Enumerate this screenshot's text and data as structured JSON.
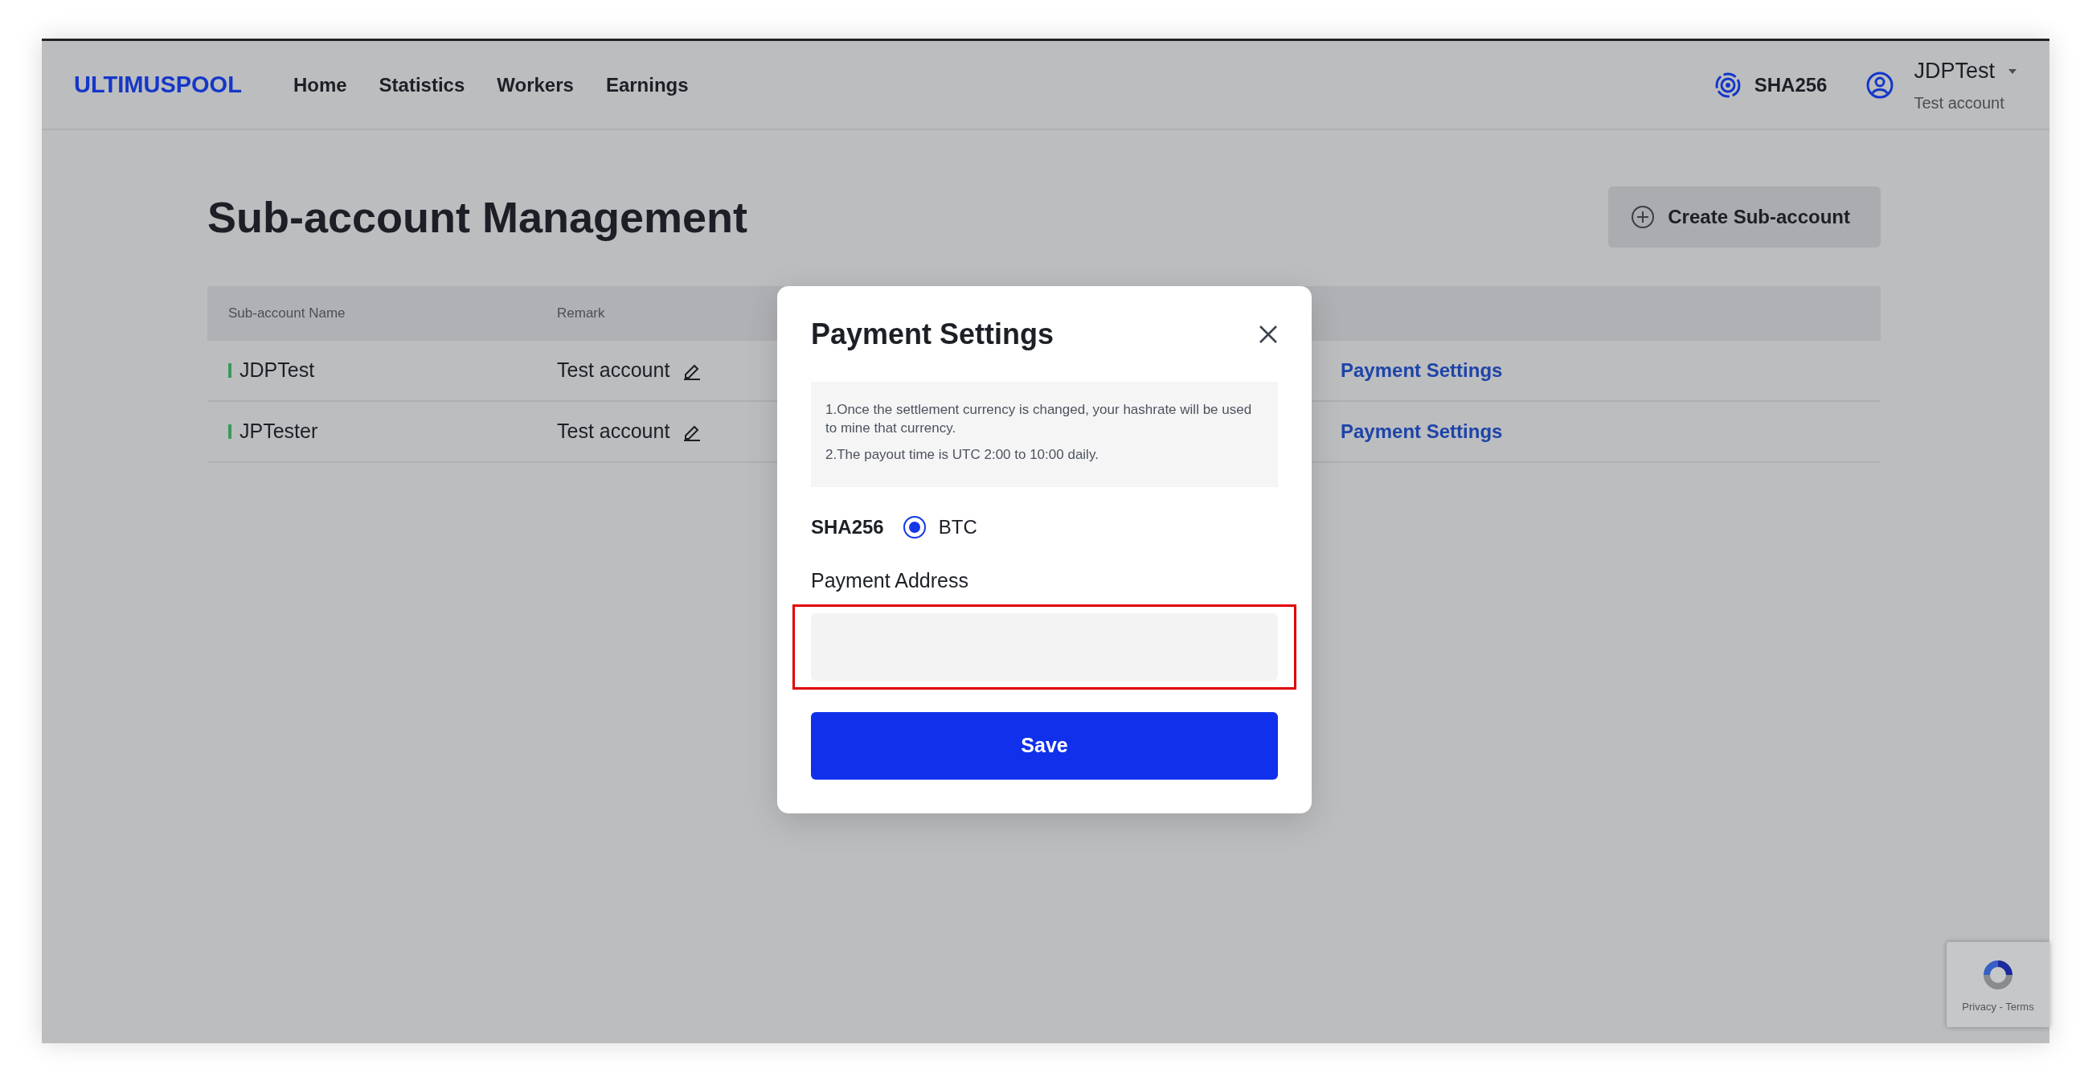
{
  "navbar": {
    "logo": "ULTIMUSPOOL",
    "links": [
      {
        "label": "Home"
      },
      {
        "label": "Statistics"
      },
      {
        "label": "Workers"
      },
      {
        "label": "Earnings"
      }
    ],
    "algorithm": "SHA256",
    "user": {
      "name": "JDPTest",
      "subtitle": "Test account"
    }
  },
  "page": {
    "title": "Sub-account Management",
    "create_button": "Create Sub-account"
  },
  "table": {
    "columns": [
      "Sub-account Name",
      "Remark"
    ],
    "rows": [
      {
        "name": "JDPTest",
        "remark": "Test account",
        "action": "Payment Settings"
      },
      {
        "name": "JPTester",
        "remark": "Test account",
        "action": "Payment Settings"
      }
    ]
  },
  "modal": {
    "title": "Payment Settings",
    "notes": [
      "1.Once the settlement currency is changed, your hashrate will be used to mine that currency.",
      "2.The payout time is UTC 2:00 to 10:00 daily."
    ],
    "algorithm": "SHA256",
    "options": [
      {
        "label": "BTC",
        "selected": true
      }
    ],
    "address_label": "Payment Address",
    "address_highlighted": true,
    "save": "Save"
  },
  "recaptcha": {
    "text": "Privacy - Terms"
  }
}
